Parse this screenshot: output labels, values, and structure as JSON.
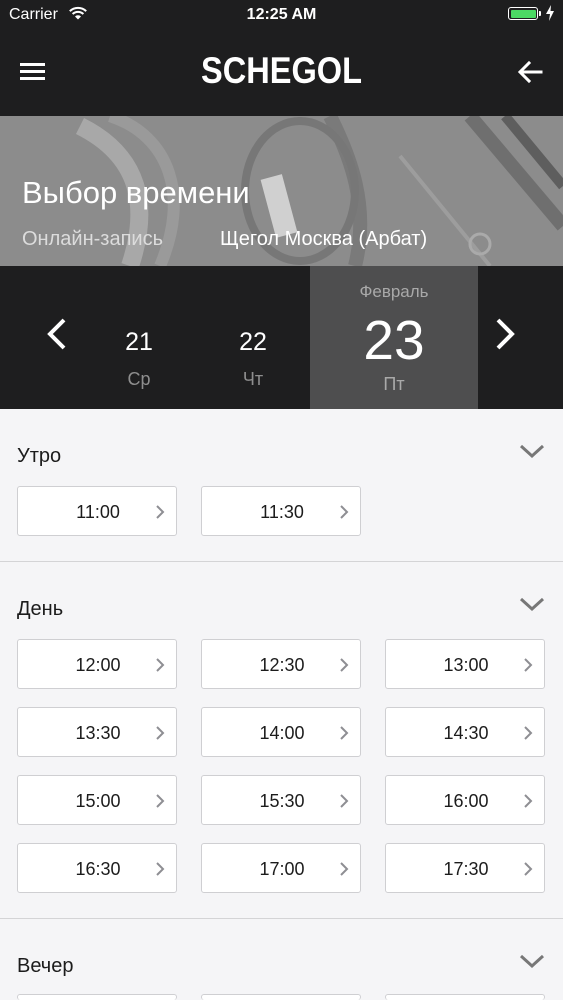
{
  "status_bar": {
    "carrier": "Carrier",
    "time": "12:25 AM",
    "battery_color": "#4cd964"
  },
  "header": {
    "logo": "SCHEGOL",
    "menu_icon": "hamburger-menu-icon",
    "back_icon": "arrow-left-icon"
  },
  "hero": {
    "title": "Выбор времени",
    "subtitle": "Онлайн-запись",
    "location": "Щегол Москва (Арбат)"
  },
  "date_picker": {
    "days": [
      {
        "num": "21",
        "dow": "Ср"
      },
      {
        "num": "22",
        "dow": "Чт"
      }
    ],
    "selected": {
      "month": "Февраль",
      "num": "23",
      "dow": "Пт"
    }
  },
  "sections": {
    "morning": {
      "title": "Утро",
      "slots": [
        "11:00",
        "11:30"
      ]
    },
    "day": {
      "title": "День",
      "slots": [
        "12:00",
        "12:30",
        "13:00",
        "13:30",
        "14:00",
        "14:30",
        "15:00",
        "15:30",
        "16:00",
        "16:30",
        "17:00",
        "17:30"
      ]
    },
    "evening": {
      "title": "Вечер",
      "slots": []
    }
  },
  "colors": {
    "dark_bar": "#1e1e1f",
    "selected_day": "#4e4e4f",
    "background": "#f5f5f7"
  }
}
